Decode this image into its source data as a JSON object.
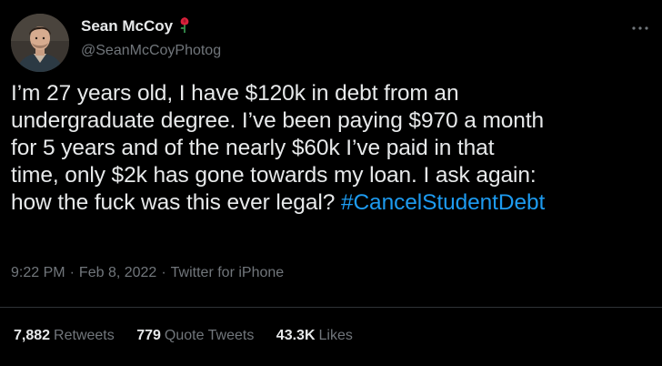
{
  "author": {
    "name": "Sean McCoy",
    "handle": "@SeanMcCoyPhotog",
    "emoji_icon": "rose-icon"
  },
  "tweet": {
    "lines": [
      "I’m 27 years old, I have $120k in debt from an",
      "undergraduate degree. I’ve been paying $970 a month",
      "for 5 years and of the nearly $60k I’ve paid in that",
      "time, only $2k has gone towards my loan. I ask again:",
      "how the fuck was this ever legal? "
    ],
    "hashtag": "#CancelStudentDebt"
  },
  "meta": {
    "time": "9:22 PM",
    "separator": "·",
    "date": "Feb 8, 2022",
    "source": "Twitter for iPhone"
  },
  "stats": {
    "retweets": {
      "count": "7,882",
      "label": "Retweets"
    },
    "quote_tweets": {
      "count": "779",
      "label": "Quote Tweets"
    },
    "likes": {
      "count": "43.3K",
      "label": "Likes"
    }
  },
  "colors": {
    "background": "#000000",
    "text": "#e7e9ea",
    "secondary": "#71767b",
    "link": "#1d9bf0",
    "divider": "#2f3336"
  }
}
